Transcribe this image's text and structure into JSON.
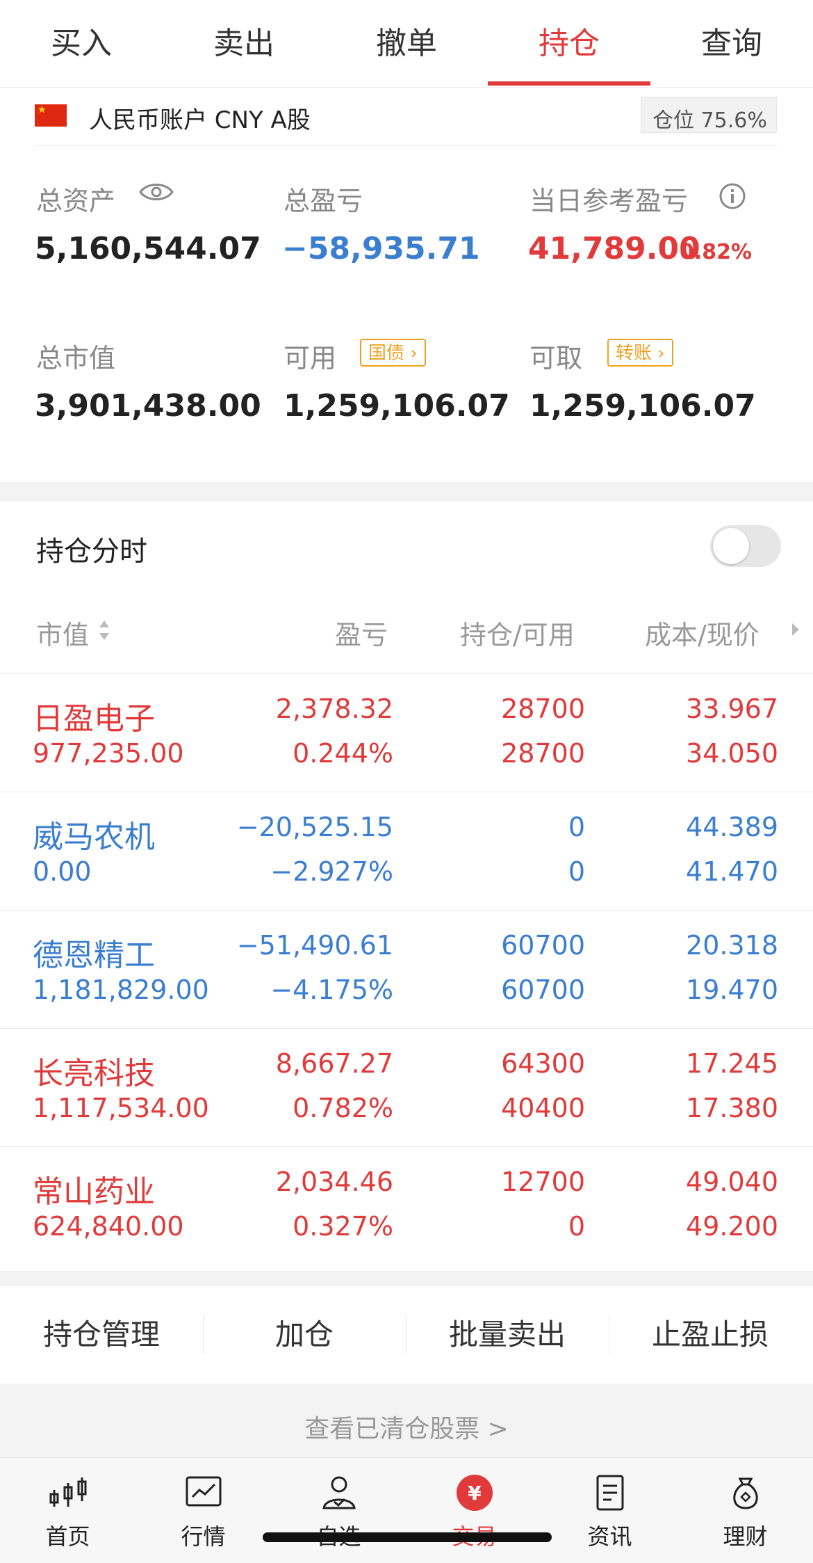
{
  "tabs": [
    "买入",
    "卖出",
    "撤单",
    "持仓",
    "查询"
  ],
  "account": {
    "label": "人民币账户 CNY A股",
    "position_label": "仓位 75.6%"
  },
  "summary": {
    "total_assets_label": "总资产",
    "total_assets": "5,160,544.07",
    "total_pl_label": "总盈亏",
    "total_pl": "−58,935.71",
    "day_pl_label": "当日参考盈亏",
    "day_pl": "41,789.00",
    "day_pl_pct": "0.82%",
    "market_value_label": "总市值",
    "market_value": "3,901,438.00",
    "available_label": "可用",
    "available_tag": "国债",
    "available": "1,259,106.07",
    "withdrawable_label": "可取",
    "withdrawable_tag": "转账",
    "withdrawable": "1,259,106.07"
  },
  "holdings": {
    "title": "持仓分时",
    "columns": [
      "市值",
      "盈亏",
      "持仓/可用",
      "成本/现价"
    ],
    "rows": [
      {
        "name": "日盈电子",
        "market_value": "977,235.00",
        "pl": "2,378.32",
        "pl_pct": "0.244%",
        "position": "28700",
        "available": "28700",
        "cost": "33.967",
        "price": "34.050",
        "color": "#e03a3a"
      },
      {
        "name": "威马农机",
        "market_value": "0.00",
        "pl": "−20,525.15",
        "pl_pct": "−2.927%",
        "position": "0",
        "available": "0",
        "cost": "44.389",
        "price": "41.470",
        "color": "#3a7ed0"
      },
      {
        "name": "德恩精工",
        "market_value": "1,181,829.00",
        "pl": "−51,490.61",
        "pl_pct": "−4.175%",
        "position": "60700",
        "available": "60700",
        "cost": "20.318",
        "price": "19.470",
        "color": "#3a7ed0"
      },
      {
        "name": "长亮科技",
        "market_value": "1,117,534.00",
        "pl": "8,667.27",
        "pl_pct": "0.782%",
        "position": "64300",
        "available": "40400",
        "cost": "17.245",
        "price": "17.380",
        "color": "#e03a3a"
      },
      {
        "name": "常山药业",
        "market_value": "624,840.00",
        "pl": "2,034.46",
        "pl_pct": "0.327%",
        "position": "12700",
        "available": "0",
        "cost": "49.040",
        "price": "49.200",
        "color": "#e03a3a"
      }
    ]
  },
  "actions": [
    "持仓管理",
    "加仓",
    "批量卖出",
    "止盈止损"
  ],
  "cleared_link": "查看已清仓股票 >",
  "nav": [
    "首页",
    "行情",
    "自选",
    "交易",
    "资讯",
    "理财"
  ]
}
